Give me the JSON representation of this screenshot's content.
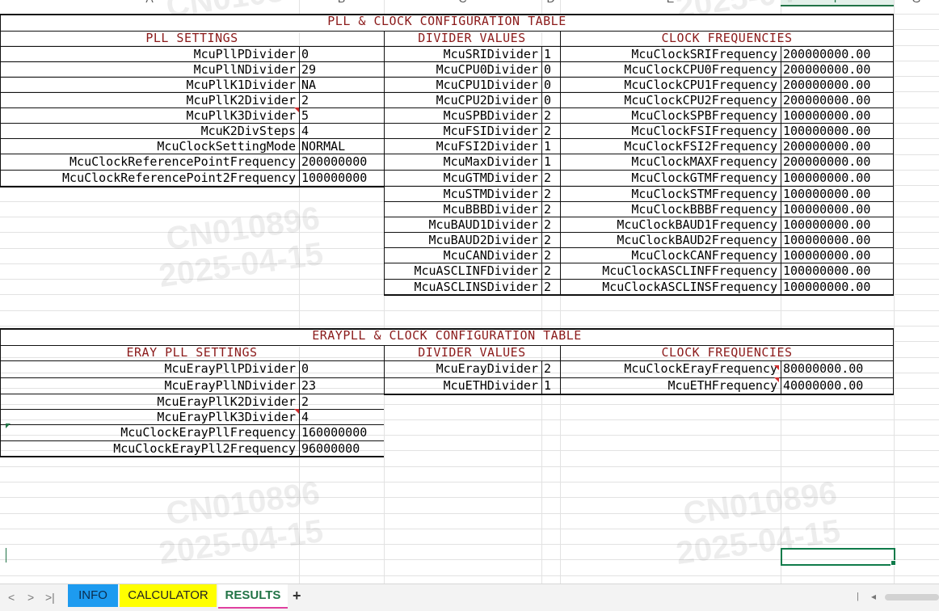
{
  "columns": [
    "A",
    "B",
    "C",
    "D",
    "E",
    "F",
    "G"
  ],
  "selected_column": "F",
  "watermark": {
    "line1": "CN010896",
    "line2": "2025-04-15"
  },
  "tables": [
    {
      "title": "PLL & CLOCK CONFIGURATION TABLE",
      "sections": [
        {
          "header": "PLL SETTINGS",
          "rows": [
            {
              "name": "McuPllPDivider",
              "value": "0"
            },
            {
              "name": "McuPllNDivider",
              "value": "29"
            },
            {
              "name": "McuPllK1Divider",
              "value": "NA"
            },
            {
              "name": "McuPllK2Divider",
              "value": "2"
            },
            {
              "name": "McuPllK3Divider",
              "value": "5"
            },
            {
              "name": "McuK2DivSteps",
              "value": "4"
            },
            {
              "name": "McuClockSettingMode",
              "value": "NORMAL"
            },
            {
              "name": "McuClockReferencePointFrequency",
              "value": "200000000"
            },
            {
              "name": "McuClockReferencePoint2Frequency",
              "value": "100000000"
            }
          ]
        },
        {
          "header": "DIVIDER VALUES",
          "rows": [
            {
              "name": "McuSRIDivider",
              "value": "1"
            },
            {
              "name": "McuCPU0Divider",
              "value": "0"
            },
            {
              "name": "McuCPU1Divider",
              "value": "0"
            },
            {
              "name": "McuCPU2Divider",
              "value": "0"
            },
            {
              "name": "McuSPBDivider",
              "value": "2"
            },
            {
              "name": "McuFSIDivider",
              "value": "2"
            },
            {
              "name": "McuFSI2Divider",
              "value": "1"
            },
            {
              "name": "McuMaxDivider",
              "value": "1"
            },
            {
              "name": "McuGTMDivider",
              "value": "2"
            },
            {
              "name": "McuSTMDivider",
              "value": "2"
            },
            {
              "name": "McuBBBDivider",
              "value": "2"
            },
            {
              "name": "McuBAUD1Divider",
              "value": "2"
            },
            {
              "name": "McuBAUD2Divider",
              "value": "2"
            },
            {
              "name": "McuCANDivider",
              "value": "2"
            },
            {
              "name": "McuASCLINFDivider",
              "value": "2"
            },
            {
              "name": "McuASCLINSDivider",
              "value": "2"
            }
          ]
        },
        {
          "header": "CLOCK FREQUENCIES",
          "rows": [
            {
              "name": "McuClockSRIFrequency",
              "value": "200000000.00"
            },
            {
              "name": "McuClockCPU0Frequency",
              "value": "200000000.00"
            },
            {
              "name": "McuClockCPU1Frequency",
              "value": "200000000.00"
            },
            {
              "name": "McuClockCPU2Frequency",
              "value": "200000000.00"
            },
            {
              "name": "McuClockSPBFrequency",
              "value": "100000000.00"
            },
            {
              "name": "McuClockFSIFrequency",
              "value": "100000000.00"
            },
            {
              "name": "McuClockFSI2Frequency",
              "value": "200000000.00"
            },
            {
              "name": "McuClockMAXFrequency",
              "value": "200000000.00"
            },
            {
              "name": "McuClockGTMFrequency",
              "value": "100000000.00"
            },
            {
              "name": "McuClockSTMFrequency",
              "value": "100000000.00"
            },
            {
              "name": "McuClockBBBFrequency",
              "value": "100000000.00"
            },
            {
              "name": "McuClockBAUD1Frequency",
              "value": "100000000.00"
            },
            {
              "name": "McuClockBAUD2Frequency",
              "value": "100000000.00"
            },
            {
              "name": "McuClockCANFrequency",
              "value": "100000000.00"
            },
            {
              "name": "McuClockASCLINFFrequency",
              "value": "100000000.00"
            },
            {
              "name": "McuClockASCLINSFrequency",
              "value": "100000000.00"
            }
          ]
        }
      ]
    },
    {
      "title": "ERAYPLL & CLOCK CONFIGURATION TABLE",
      "sections": [
        {
          "header": "ERAY PLL SETTINGS",
          "rows": [
            {
              "name": "McuErayPllPDivider",
              "value": "0"
            },
            {
              "name": "McuErayPllNDivider",
              "value": "23"
            },
            {
              "name": "McuErayPllK2Divider",
              "value": "2"
            },
            {
              "name": "McuErayPllK3Divider",
              "value": "4"
            },
            {
              "name": "McuClockErayPllFrequency",
              "value": "160000000"
            },
            {
              "name": "McuClockErayPll2Frequency",
              "value": "96000000"
            }
          ]
        },
        {
          "header": "DIVIDER VALUES",
          "rows": [
            {
              "name": "McuErayDivider",
              "value": "2"
            },
            {
              "name": "McuETHDivider",
              "value": "1"
            }
          ]
        },
        {
          "header": "CLOCK FREQUENCIES",
          "rows": [
            {
              "name": "McuClockErayFrequency",
              "value": "80000000.00"
            },
            {
              "name": "McuETHFrequency",
              "value": "40000000.00"
            }
          ]
        }
      ]
    }
  ],
  "sheet_tabs": [
    {
      "label": "INFO",
      "color": "#1d9bf0"
    },
    {
      "label": "CALCULATOR",
      "color": "#ffff00"
    },
    {
      "label": "RESULTS",
      "color": "#ffffff",
      "active": true
    }
  ],
  "add_sheet_label": "+",
  "nav": {
    "prev": "<",
    "next": ">",
    "last": ">|"
  }
}
